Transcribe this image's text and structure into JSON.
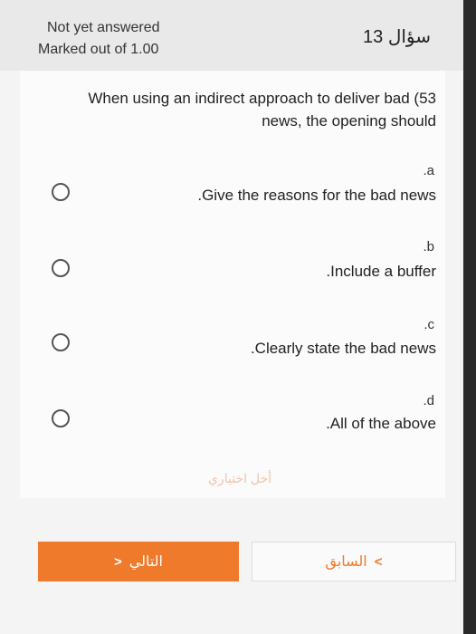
{
  "header": {
    "status": "Not yet answered",
    "marks": "Marked out of 1.00",
    "question_number": "سؤال 13"
  },
  "question": {
    "text": "When using an indirect approach to deliver bad (53 news, the opening should"
  },
  "options": [
    {
      "letter": ".a",
      "text": ".Give the reasons for the bad news"
    },
    {
      "letter": ".b",
      "text": ".Include a buffer"
    },
    {
      "letter": ".c",
      "text": ".Clearly state the bad news"
    },
    {
      "letter": ".d",
      "text": ".All of the above"
    }
  ],
  "clear_choice": "أخل اختياري",
  "nav": {
    "next_label": "التالي",
    "prev_label": "السابق"
  },
  "colors": {
    "accent": "#f07a2b"
  }
}
